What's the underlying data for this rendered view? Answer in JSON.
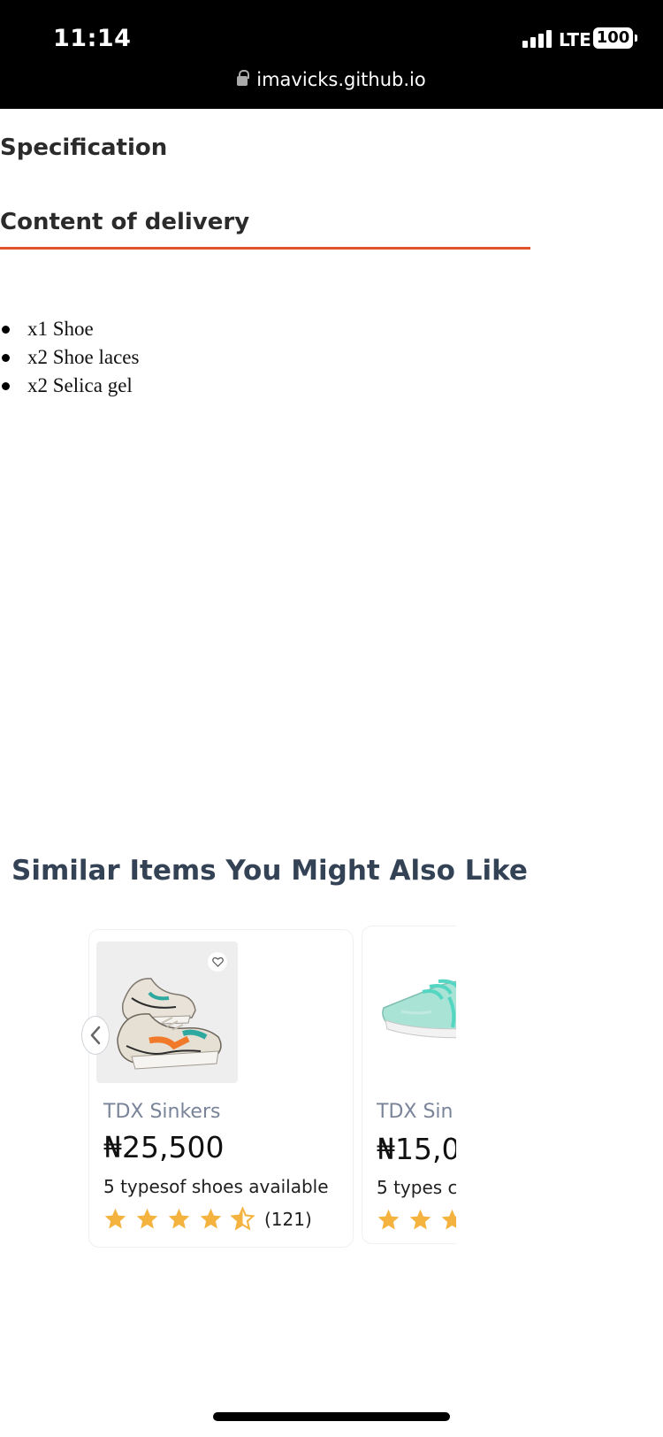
{
  "status_bar": {
    "time": "11:14",
    "network": "LTE",
    "battery": "100",
    "url": "imavicks.github.io"
  },
  "tabs": {
    "specification": "Specification",
    "content_of_delivery": "Content of delivery",
    "active_color": "#e0522c"
  },
  "delivery_items": [
    "x1 Shoe",
    "x2 Shoe laces",
    "x2 Selica gel"
  ],
  "similar": {
    "title": "Similar Items You Might Also Like",
    "items": [
      {
        "name": "TDX Sinkers",
        "price": "₦25,500",
        "types": "5 typesof shoes available",
        "rating": 4.5,
        "rating_count": "(121)",
        "image": "sneaker-image"
      },
      {
        "name": "TDX Sin",
        "price": "₦15,0(",
        "types": "5 types c",
        "image": "mint-sneaker-image"
      }
    ]
  },
  "colors": {
    "star": "#f4b33f",
    "title": "#344256"
  }
}
